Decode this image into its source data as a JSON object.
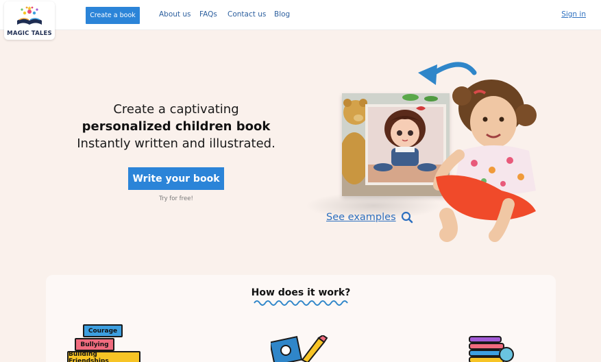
{
  "header": {
    "logo_text": "MAGIC TALES",
    "create_button": "Create a book",
    "nav": [
      "About us",
      "FAQs",
      "Contact us",
      "Blog"
    ],
    "sign_in": "Sign in"
  },
  "hero": {
    "line1": "Create a captivating",
    "line2": "personalized children book",
    "line3": "Instantly written and illustrated.",
    "cta": "Write your book",
    "cta_sub": "Try for free!",
    "see_examples": "See examples"
  },
  "how": {
    "title": "How does it work?",
    "tags": [
      "Courage",
      "Bullying",
      "Building Friendships"
    ]
  },
  "colors": {
    "accent": "#2b84d8",
    "background": "#faf1ec",
    "link": "#2c6fbf"
  }
}
